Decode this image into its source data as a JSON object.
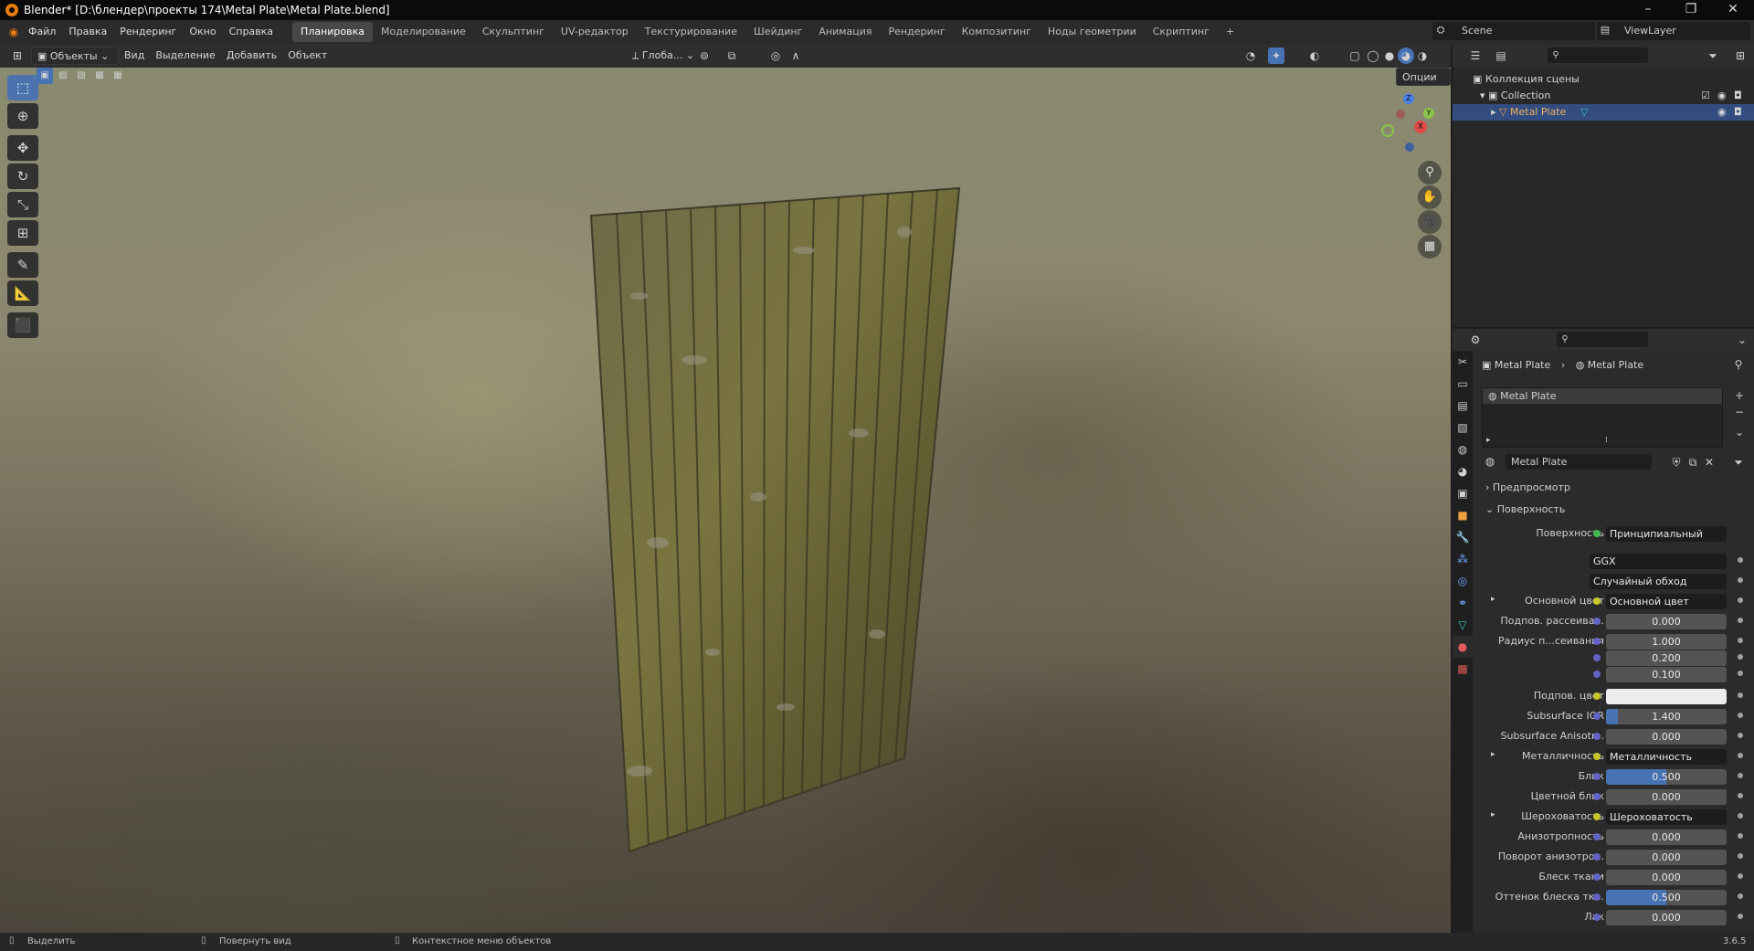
{
  "window": {
    "title": "Blender* [D:\\блендер\\проекты 174\\Metal Plate\\Metal Plate.blend]",
    "controls": {
      "minimize": "–",
      "maximize": "❐",
      "close": "✕"
    }
  },
  "menu": {
    "items": [
      "Файл",
      "Правка",
      "Рендеринг",
      "Окно",
      "Справка"
    ],
    "workspaces": [
      "Планировка",
      "Моделирование",
      "Скульптинг",
      "UV-редактор",
      "Текстурирование",
      "Шейдинг",
      "Анимация",
      "Рендеринг",
      "Композитинг",
      "Ноды геометрии",
      "Скриптинг"
    ],
    "active_workspace": "Планировка",
    "add_workspace": "+",
    "scene": "Scene",
    "view_layer": "ViewLayer"
  },
  "viewport_header": {
    "mode": "Объекты",
    "menus": [
      "Вид",
      "Выделение",
      "Добавить",
      "Объект"
    ],
    "transform_orientation": "Глоба...",
    "options": "Опции"
  },
  "gizmo": {
    "x": "X",
    "y": "Y",
    "z": "Z"
  },
  "outliner": {
    "scene_collection": "Коллекция сцены",
    "collection": "Collection",
    "object": "Metal Plate"
  },
  "properties": {
    "breadcrumb_object": "Metal Plate",
    "breadcrumb_material": "Metal Plate",
    "material_slot": "Metal Plate",
    "material_name": "Metal Plate",
    "panels": {
      "preview": "Предпросмотр",
      "surface": "Поверхность"
    },
    "surface_label": "Поверхность",
    "surface_shader": "Принципиальный BSDF",
    "distribution": "GGX",
    "subsurface_method": "Случайный обход",
    "fields": [
      {
        "label": "Основной цвет",
        "value": "Основной цвет",
        "kind": "link",
        "expand": true
      },
      {
        "label": "Подпов. рассеива...",
        "value": "0.000",
        "kind": "num",
        "fill": 0
      },
      {
        "label": "Радиус п...сеивания",
        "value": "1.000",
        "kind": "num",
        "fill": 0
      },
      {
        "label": "",
        "value": "0.200",
        "kind": "num",
        "fill": 0
      },
      {
        "label": "",
        "value": "0.100",
        "kind": "num",
        "fill": 0
      },
      {
        "label": "Подпов. цвет",
        "value": "",
        "kind": "color"
      },
      {
        "label": "Subsurface IOR",
        "value": "1.400",
        "kind": "num",
        "fill": 0.1
      },
      {
        "label": "Subsurface Anisotr...",
        "value": "0.000",
        "kind": "num",
        "fill": 0
      },
      {
        "label": "Металличность",
        "value": "Металличность",
        "kind": "link",
        "expand": true
      },
      {
        "label": "Блик",
        "value": "0.500",
        "kind": "num",
        "fill": 0.5
      },
      {
        "label": "Цветной блик",
        "value": "0.000",
        "kind": "num",
        "fill": 0
      },
      {
        "label": "Шероховатость",
        "value": "Шероховатость",
        "kind": "link",
        "expand": true
      },
      {
        "label": "Анизотропность",
        "value": "0.000",
        "kind": "num",
        "fill": 0
      },
      {
        "label": "Поворот анизотро...",
        "value": "0.000",
        "kind": "num",
        "fill": 0
      },
      {
        "label": "Блеск ткани",
        "value": "0.000",
        "kind": "num",
        "fill": 0
      },
      {
        "label": "Оттенок блеска тк...",
        "value": "0.500",
        "kind": "num",
        "fill": 0.5
      },
      {
        "label": "Лак",
        "value": "0.000",
        "kind": "num",
        "fill": 0
      }
    ]
  },
  "status_bar": {
    "select": "Выделить",
    "rotate": "Повернуть вид",
    "context": "Контекстное меню объектов",
    "version": "3.6.5"
  },
  "colors": {
    "accent": "#4772b3",
    "selection": "#334d80",
    "plate": "#6b6a3a"
  }
}
